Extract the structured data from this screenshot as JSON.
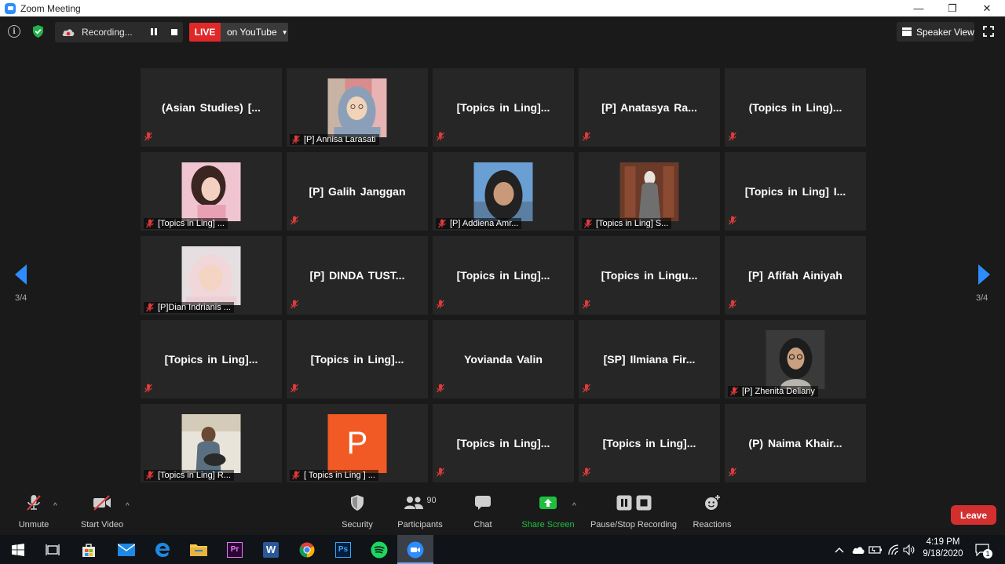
{
  "window": {
    "title": "Zoom Meeting",
    "controls": {
      "minimize": "—",
      "restore": "❐",
      "close": "✕"
    }
  },
  "topbar": {
    "info_icon": "i",
    "recording_label": "Recording...",
    "live_label": "LIVE",
    "stream_label": "on YouTube",
    "stream_caret": "▼",
    "view_label": "Speaker View"
  },
  "pagination": {
    "left": "3/4",
    "right": "3/4"
  },
  "tiles": [
    {
      "name": "(Asian Studies) [...",
      "video": false
    },
    {
      "name": "[P] Annisa Larasati",
      "video": true,
      "photo": "p1"
    },
    {
      "name": "[Topics in Ling]...",
      "video": false
    },
    {
      "name": "[P] Anatasya Ra...",
      "video": false
    },
    {
      "name": "(Topics in Ling)...",
      "video": false
    },
    {
      "name": "[Topics in Ling] ...",
      "video": true,
      "photo": "p2"
    },
    {
      "name": "[P] Galih Janggan",
      "video": false
    },
    {
      "name": "[P] Addiena Amr...",
      "video": true,
      "photo": "p3"
    },
    {
      "name": "[Topics in Ling] S...",
      "video": true,
      "photo": "p4"
    },
    {
      "name": "[Topics in Ling] I...",
      "video": false
    },
    {
      "name": "[P]Dian Indrianis ...",
      "video": true,
      "photo": "p5"
    },
    {
      "name": "[P] DINDA TUST...",
      "video": false
    },
    {
      "name": "[Topics in Ling]...",
      "video": false
    },
    {
      "name": "[Topics in Lingu...",
      "video": false
    },
    {
      "name": "[P] Afifah Ainiyah",
      "video": false
    },
    {
      "name": "[Topics in Ling]...",
      "video": false
    },
    {
      "name": "[Topics in Ling]...",
      "video": false
    },
    {
      "name": "Yovianda Valin",
      "video": false
    },
    {
      "name": "[SP] Ilmiana Fir...",
      "video": false
    },
    {
      "name": "[P] Zhenita Deliany",
      "video": true,
      "photo": "p6"
    },
    {
      "name": "[Topics in Ling] R...",
      "video": true,
      "photo": "p7"
    },
    {
      "name": "[ Topics in Ling ] ...",
      "video": true,
      "photo": "p8",
      "avatar_letter": "P"
    },
    {
      "name": "[Topics in Ling]...",
      "video": false
    },
    {
      "name": "[Topics in Ling]...",
      "video": false
    },
    {
      "name": "(P) Naima Khair...",
      "video": false
    }
  ],
  "toolbar": {
    "unmute": "Unmute",
    "start_video": "Start Video",
    "security": "Security",
    "participants": "Participants",
    "participants_count": "90",
    "chat": "Chat",
    "share_screen": "Share Screen",
    "pause_stop_recording": "Pause/Stop Recording",
    "reactions": "Reactions",
    "leave": "Leave",
    "caret": "^"
  },
  "taskbar": {
    "time": "4:19 PM",
    "date": "9/18/2020",
    "notification_count": "1",
    "word_letter": "W",
    "ps_letters": "Ps",
    "pr_letters": "Pr"
  },
  "colors": {
    "accent": "#2d8cff",
    "live": "#e02828",
    "leave": "#d32f2f",
    "share": "#1fbf3f",
    "muted": "#e03b3b"
  }
}
